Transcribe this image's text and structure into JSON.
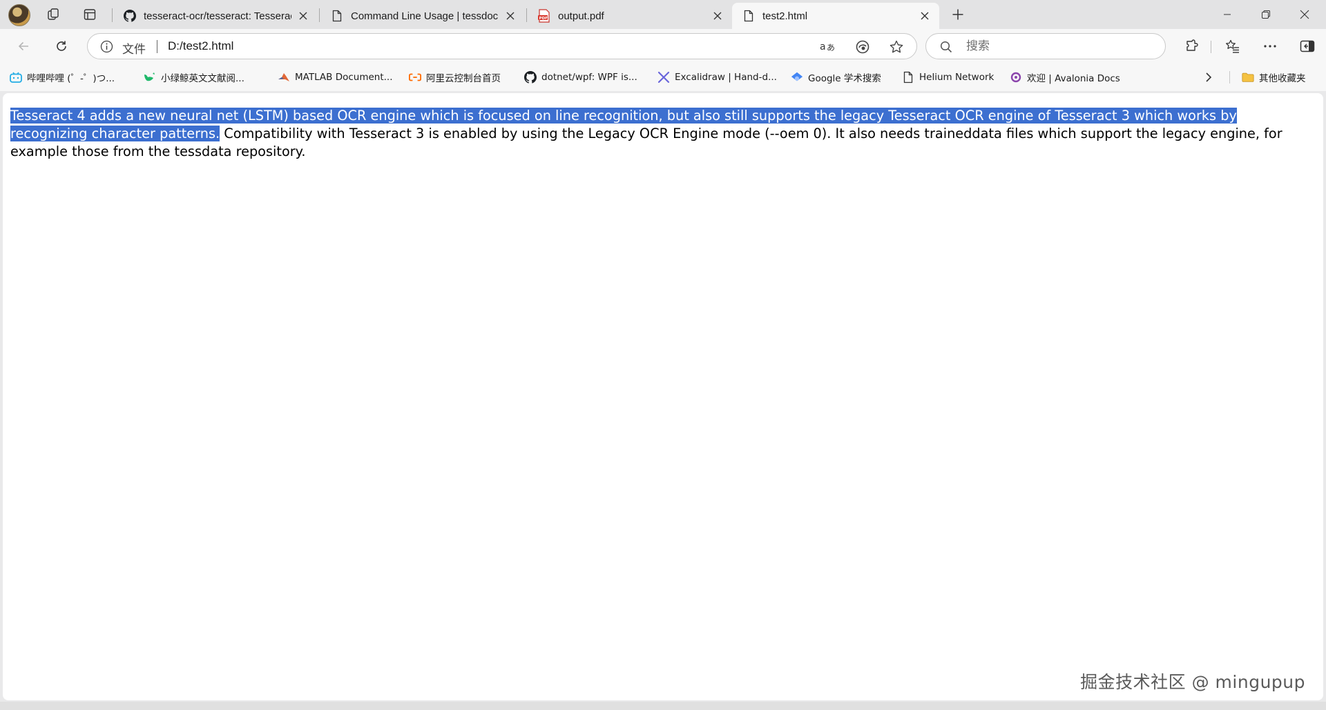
{
  "browser": {
    "tabs": [
      {
        "title": "tesseract-ocr/tesseract: Tesseract Open Source OCR Engine",
        "icon": "github-icon"
      },
      {
        "title": "Command Line Usage | tessdoc",
        "icon": "page-icon"
      },
      {
        "title": "output.pdf",
        "icon": "pdf-icon"
      },
      {
        "title": "test2.html",
        "icon": "page-icon",
        "active": true
      }
    ],
    "new_tab_label": "+"
  },
  "toolbar": {
    "scheme_label": "文件",
    "url": "D:/test2.html",
    "search_placeholder": "搜索"
  },
  "favorites": {
    "items": [
      {
        "label": "哔哩哔哩 (゜-゜)つ...",
        "icon": "bilibili-icon"
      },
      {
        "label": "小绿鲸英文文献阅...",
        "icon": "whale-icon"
      },
      {
        "label": "MATLAB Document...",
        "icon": "matlab-icon"
      },
      {
        "label": "阿里云控制台首页",
        "icon": "aliyun-icon"
      },
      {
        "label": "dotnet/wpf: WPF is...",
        "icon": "github-icon"
      },
      {
        "label": "Excalidraw | Hand-d...",
        "icon": "excalidraw-icon"
      },
      {
        "label": "Google 学术搜索",
        "icon": "scholar-icon"
      },
      {
        "label": "Helium Network",
        "icon": "page-icon"
      },
      {
        "label": "欢迎 | Avalonia Docs",
        "icon": "avalonia-icon"
      }
    ],
    "other_label": "其他收藏夹"
  },
  "page": {
    "selected_text": "Tesseract 4 adds a new neural net (LSTM) based OCR engine which is focused on line recognition, but also still supports the legacy Tesseract OCR engine of Tesseract 3 which works by recognizing character patterns.",
    "rest_text": " Compatibility with Tesseract 3 is enabled by using the Legacy OCR Engine mode (--oem 0). It also needs traineddata files which support the legacy engine, for example those from the tessdata repository."
  },
  "watermark": "掘金技术社区 @ mingupup",
  "colors": {
    "selection": "#3c6fd0",
    "background": "#ffffff",
    "chrome": "#e3e3e4"
  }
}
